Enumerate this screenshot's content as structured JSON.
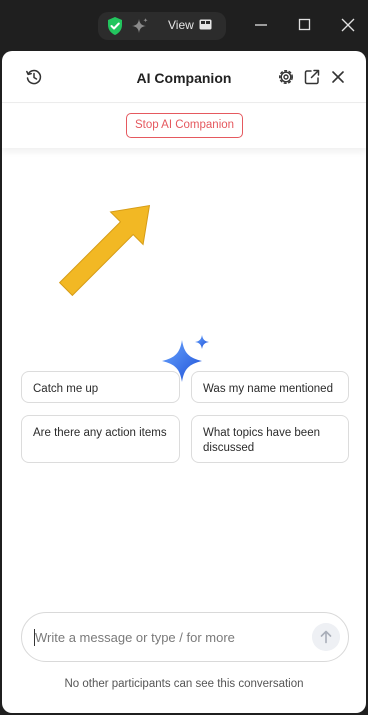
{
  "titlebar": {
    "view_label": "View"
  },
  "panel": {
    "title": "AI Companion",
    "stop_button": "Stop AI Companion",
    "suggestions": [
      "Catch me up",
      "Was my name mentioned",
      "Are there any action items",
      "What topics have been discussed"
    ],
    "input": {
      "placeholder": "Write a message or type / for more",
      "value": ""
    },
    "footer_note": "No other participants can see this conversation"
  },
  "colors": {
    "accent_red": "#e5595f",
    "sparkle_blue": "#2f6fe8",
    "shield_green": "#22c55e",
    "annotation_arrow": "#f2b824"
  },
  "icons": {
    "titlebar": [
      "shield-check-icon",
      "sparkle-icon",
      "view-grid-icon",
      "minimize-icon",
      "maximize-icon",
      "close-window-icon"
    ],
    "header": [
      "history-icon",
      "gear-icon",
      "popout-icon",
      "close-icon"
    ],
    "composer": [
      "send-arrow-icon"
    ]
  }
}
